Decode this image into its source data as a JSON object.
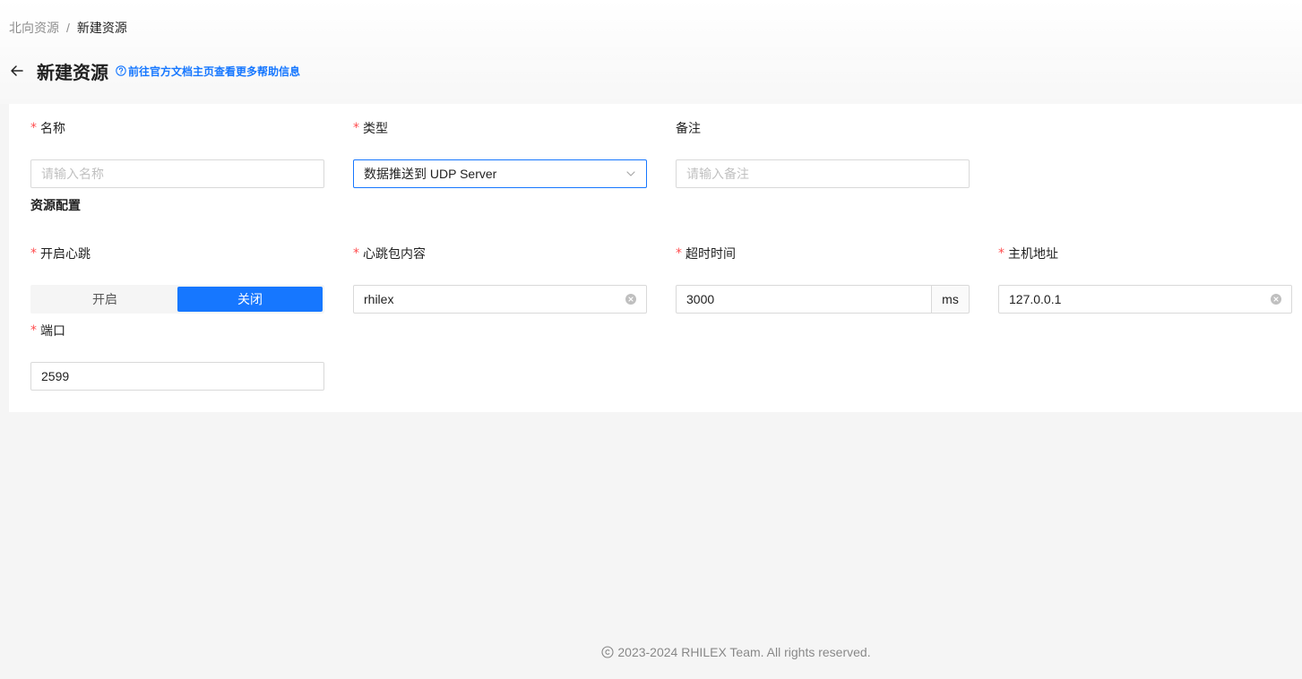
{
  "breadcrumb": {
    "parent": "北向资源",
    "separator": "/",
    "current": "新建资源"
  },
  "header": {
    "title": "新建资源",
    "help_link": "前往官方文档主页查看更多帮助信息"
  },
  "form": {
    "name": {
      "label": "名称",
      "placeholder": "请输入名称",
      "required": true
    },
    "type": {
      "label": "类型",
      "value": "数据推送到 UDP Server",
      "required": true
    },
    "remark": {
      "label": "备注",
      "placeholder": "请输入备注",
      "required": false
    }
  },
  "config": {
    "section_title": "资源配置",
    "heartbeat": {
      "label": "开启心跳",
      "options": [
        "开启",
        "关闭"
      ],
      "selected": "关闭"
    },
    "heartbeat_content": {
      "label": "心跳包内容",
      "value": "rhilex"
    },
    "timeout": {
      "label": "超时时间",
      "value": "3000",
      "unit": "ms"
    },
    "host": {
      "label": "主机地址",
      "value": "127.0.0.1"
    },
    "port": {
      "label": "端口",
      "value": "2599"
    }
  },
  "required_mark": "*",
  "footer": {
    "copyright": "2023-2024 RHILEX Team. All rights reserved."
  },
  "colors": {
    "primary": "#1677ff",
    "required": "#ff4d4f",
    "border": "#d9d9d9",
    "background": "#f5f5f5"
  }
}
